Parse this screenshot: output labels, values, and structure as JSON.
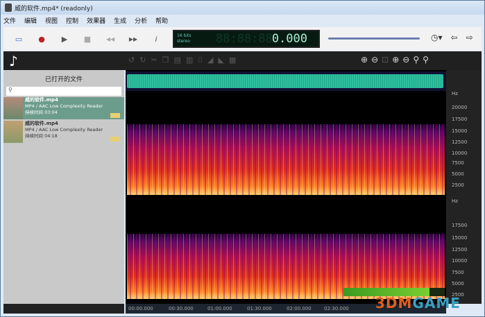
{
  "window": {
    "title": "威的软件.mp4* (readonly)"
  },
  "menu": [
    "文件",
    "编辑",
    "视图",
    "控制",
    "效果器",
    "生成",
    "分析",
    "帮助"
  ],
  "toolbar": {
    "icons": [
      "selection-icon",
      "record-icon",
      "play-icon",
      "stop-icon",
      "rewind-icon",
      "fast-forward-icon",
      "info-icon"
    ],
    "glyphs": [
      "▭",
      "●",
      "▶",
      "■",
      "◀◀",
      "▶▶",
      "i"
    ],
    "record_color": "#c0202a"
  },
  "display": {
    "format_line1": "16 bits",
    "format_line2": "stereo",
    "ghost": "88:88:88",
    "time": "0.000"
  },
  "volume": {
    "level": 0.95
  },
  "sidebar": {
    "title": "已打开的文件",
    "search_placeholder": "",
    "files": [
      {
        "name": "威的软件.mp4",
        "codec": "MP4 / AAC Low Complexity Reader",
        "duration": "持续时间 03:04"
      },
      {
        "name": "威的软件.mp4",
        "codec": "MP4 / AAC Low Complexity Reader",
        "duration": "持续时间 04:18"
      }
    ]
  },
  "freq_axis": {
    "unit": "Hz",
    "labels": [
      "20000",
      "17500",
      "15000",
      "12500",
      "10000",
      "7500",
      "5000",
      "2500"
    ]
  },
  "time_axis": [
    "00:00.000",
    "00:30.000",
    "01:00.000",
    "01:30.000",
    "02:00.000",
    "02:30.000"
  ],
  "level_meter": {
    "level": 0.85
  },
  "watermark": {
    "part1": "3DM",
    "part2": "GAME"
  }
}
